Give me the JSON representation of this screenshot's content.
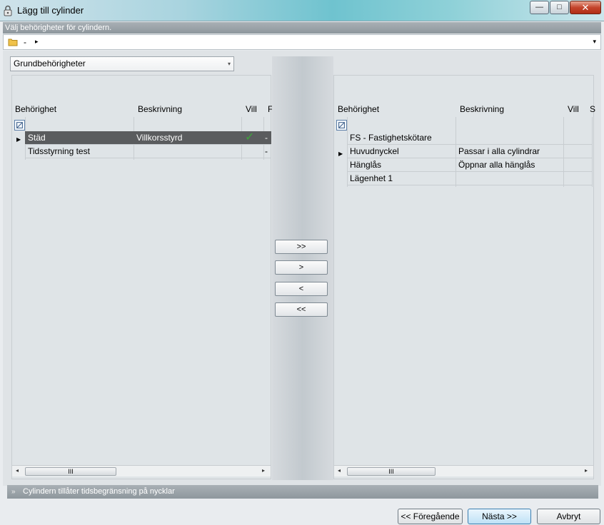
{
  "window": {
    "title": "Lägg till cylinder",
    "minimize_glyph": "—",
    "maximize_glyph": "□",
    "close_glyph": "✕"
  },
  "instruction": "Välj behörigheter för cylindern.",
  "breadcrumb": {
    "separator": "-",
    "arrow": "▸",
    "dropdown": "▾"
  },
  "combo": {
    "value": "Grundbehörigheter",
    "caret": "▾"
  },
  "left_grid": {
    "columns": [
      "Behörighet",
      "Beskrivning",
      "Vill",
      "F"
    ],
    "rows": [
      {
        "name": "Städ",
        "desc": "Villkorsstyrd",
        "vill": "✓",
        "extra": "-"
      },
      {
        "name": "Tidsstyrning test",
        "desc": "",
        "vill": "",
        "extra": "-"
      }
    ],
    "pointer": "▶",
    "scroll_thumb": "III",
    "scroll_left": "◂",
    "scroll_right": "▸"
  },
  "right_grid": {
    "columns": [
      "Behörighet",
      "Beskrivning",
      "Vill",
      "S"
    ],
    "rows": [
      {
        "name": "FS - Fastighetskötare",
        "desc": ""
      },
      {
        "name": "Huvudnyckel",
        "desc": "Passar i alla cylindrar"
      },
      {
        "name": "Hänglås",
        "desc": "Öppnar alla hänglås"
      },
      {
        "name": "Lägenhet 1",
        "desc": ""
      }
    ],
    "pointer": "▶",
    "scroll_thumb": "III",
    "scroll_left": "◂",
    "scroll_right": "▸"
  },
  "movers": {
    "all_right": ">>",
    "one_right": ">",
    "one_left": "<",
    "all_left": "<<"
  },
  "footer": {
    "chevron": "»",
    "text": "Cylindern tillåter tidsbegränsning på nycklar"
  },
  "buttons": {
    "previous": "<< Föregående",
    "next": "Nästa >>",
    "cancel": "Avbryt"
  },
  "colors": {
    "selected_row": "#5a5c5e",
    "check": "#3ea53b",
    "accent_button": "#bfe1f6"
  }
}
